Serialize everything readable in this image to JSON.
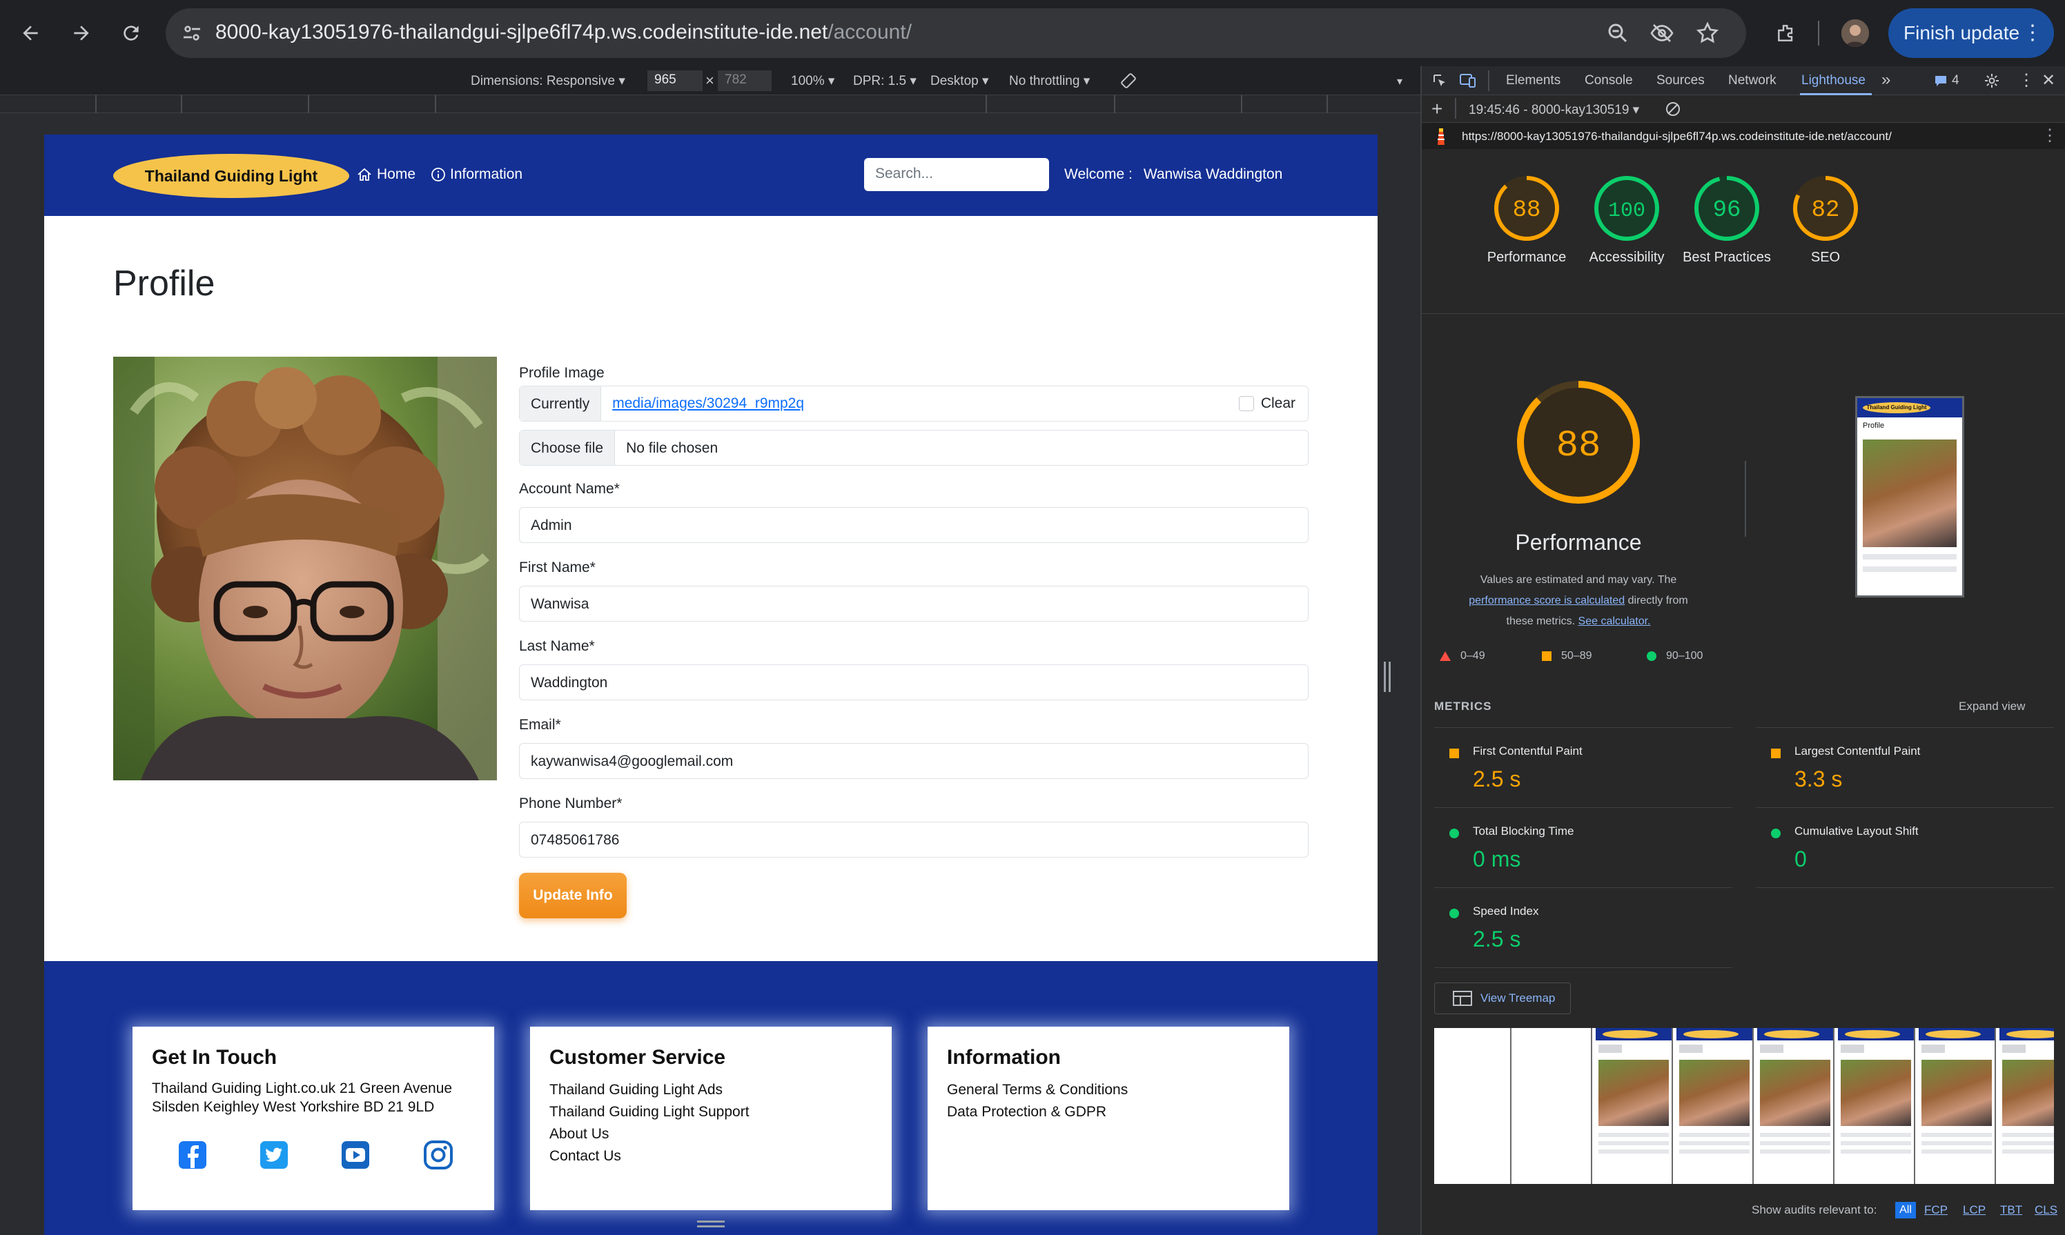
{
  "browser": {
    "url_host": "8000-kay13051976-thailandgui-sjlpe6fl74p.ws.codeinstitute-ide.net",
    "url_path": "/account/",
    "finish_update_label": "Finish update"
  },
  "device_toolbar": {
    "dimensions": "Dimensions: Responsive ▾",
    "width": "965",
    "x_sep": "×",
    "height": "782",
    "zoom": "100% ▾",
    "dpr": "DPR: 1.5 ▾",
    "device": "Desktop ▾",
    "throttle": "No throttling ▾"
  },
  "site": {
    "brand": "Thailand Guiding Light",
    "nav_home": "Home",
    "nav_info": "Information",
    "search_placeholder": "Search...",
    "welcome_label": "Welcome :",
    "welcome_name": "Wanwisa Waddington",
    "page_title": "Profile",
    "form": {
      "profile_image_label": "Profile Image",
      "currently_label": "Currently",
      "current_image": "media/images/30294_r9mp2q",
      "clear_label": "Clear",
      "choose_file_label": "Choose file",
      "no_file_label": "No file chosen",
      "account_name_label": "Account Name*",
      "account_name": "Admin",
      "first_name_label": "First Name*",
      "first_name": "Wanwisa",
      "last_name_label": "Last Name*",
      "last_name": "Waddington",
      "email_label": "Email*",
      "email": "kaywanwisa4@googlemail.com",
      "phone_label": "Phone Number*",
      "phone": "07485061786",
      "submit_label": "Update Info"
    },
    "footer": {
      "contact_title": "Get In Touch",
      "contact_line1": "Thailand Guiding Light.co.uk 21 Green Avenue",
      "contact_line2": "Silsden Keighley West Yorkshire BD 21 9LD",
      "social_icons": [
        "facebook-icon",
        "twitter-icon",
        "youtube-icon",
        "instagram-icon"
      ],
      "service_title": "Customer Service",
      "service_links": [
        "Thailand Guiding Light Ads",
        "Thailand Guiding Light Support",
        "About Us",
        "Contact Us"
      ],
      "info_title": "Information",
      "info_links": [
        "General Terms & Conditions",
        "Data Protection & GDPR"
      ]
    }
  },
  "devtools": {
    "tabs": [
      "Elements",
      "Console",
      "Sources",
      "Network",
      "Lighthouse"
    ],
    "issues_count": "4",
    "report_time": "19:45:46 - 8000-kay130519 ▾",
    "report_url": "https://8000-kay13051976-thailandgui-sjlpe6fl74p.ws.codeinstitute-ide.net/account/",
    "scores": [
      {
        "label": "Performance",
        "score": 88
      },
      {
        "label": "Accessibility",
        "score": 100
      },
      {
        "label": "Best Practices",
        "score": 96
      },
      {
        "label": "SEO",
        "score": 82
      }
    ],
    "big_score": "88",
    "big_title": "Performance",
    "desc_pre": "Values are estimated and may vary. The",
    "desc_link": "performance score is calculated",
    "desc_mid": "directly from these metrics.",
    "desc_calc": "See calculator.",
    "legend": [
      "0–49",
      "50–89",
      "90–100"
    ],
    "metrics_label": "METRICS",
    "expand_view": "Expand view",
    "metrics": [
      {
        "name": "First Contentful Paint",
        "value": "2.5 s",
        "status": "average"
      },
      {
        "name": "Largest Contentful Paint",
        "value": "3.3 s",
        "status": "average"
      },
      {
        "name": "Total Blocking Time",
        "value": "0 ms",
        "status": "pass"
      },
      {
        "name": "Cumulative Layout Shift",
        "value": "0",
        "status": "pass"
      },
      {
        "name": "Speed Index",
        "value": "2.5 s",
        "status": "pass"
      }
    ],
    "view_treemap": "View Treemap",
    "audits_label": "Show audits relevant to:",
    "audit_filters": [
      "All",
      "FCP",
      "LCP",
      "TBT",
      "CLS"
    ],
    "colors": {
      "pass": "#0cce6b",
      "average": "#ffa400",
      "fail": "#ff4e42"
    }
  },
  "mini_preview": {
    "brand": "Thailand Guiding Light",
    "title": "Profile"
  }
}
